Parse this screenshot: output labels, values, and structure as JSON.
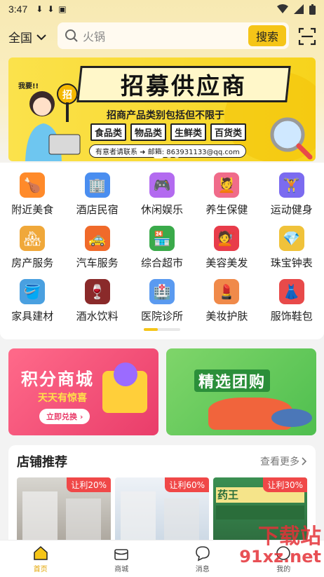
{
  "status_bar": {
    "time": "3:47"
  },
  "search": {
    "city": "全国",
    "placeholder": "火锅",
    "button": "搜索"
  },
  "banner": {
    "title": "招募供应商",
    "subtitle": "招商产品类别包括但不限于",
    "categories": [
      "食品类",
      "物品类",
      "生鲜类",
      "百货类"
    ],
    "contact": "有意者请联系 ➜ 邮箱: 863931133@qq.com",
    "badge": "招",
    "person_text": "我要!!"
  },
  "categories": [
    {
      "label": "附近美食",
      "icon": "food-icon",
      "color": "#ff8a2a",
      "glyph": "🍗"
    },
    {
      "label": "酒店民宿",
      "icon": "hotel-icon",
      "color": "#4a8ef0",
      "glyph": "🏢"
    },
    {
      "label": "休闲娱乐",
      "icon": "gamepad-icon",
      "color": "#b36bf0",
      "glyph": "🎮"
    },
    {
      "label": "养生保健",
      "icon": "spa-icon",
      "color": "#f06b8a",
      "glyph": "💆"
    },
    {
      "label": "运动健身",
      "icon": "fitness-icon",
      "color": "#7b6bf0",
      "glyph": "🏋"
    },
    {
      "label": "房产服务",
      "icon": "building-icon",
      "color": "#f0a83a",
      "glyph": "🏘"
    },
    {
      "label": "汽车服务",
      "icon": "car-icon",
      "color": "#f06a2a",
      "glyph": "🚕"
    },
    {
      "label": "综合超市",
      "icon": "supermarket-icon",
      "color": "#3aaa4a",
      "glyph": "🏪"
    },
    {
      "label": "美容美发",
      "icon": "hair-icon",
      "color": "#e83c4a",
      "glyph": "💇"
    },
    {
      "label": "珠宝钟表",
      "icon": "jewelry-icon",
      "color": "#f0c23a",
      "glyph": "💎"
    },
    {
      "label": "家具建材",
      "icon": "paint-icon",
      "color": "#4aa0e0",
      "glyph": "🪣"
    },
    {
      "label": "酒水饮料",
      "icon": "wine-icon",
      "color": "#8a2a2a",
      "glyph": "🍷"
    },
    {
      "label": "医院诊所",
      "icon": "hospital-icon",
      "color": "#5a9af0",
      "glyph": "🏥"
    },
    {
      "label": "美妆护肤",
      "icon": "cosmetics-icon",
      "color": "#f08a4a",
      "glyph": "💄"
    },
    {
      "label": "服饰鞋包",
      "icon": "clothing-icon",
      "color": "#e84a4a",
      "glyph": "👗"
    }
  ],
  "pager": {
    "pages": 2,
    "current": 1
  },
  "promos": {
    "points_mall": {
      "title": "积分商城",
      "subtitle": "天天有惊喜",
      "button": "立即兑换"
    },
    "group_buy": {
      "title": "精选团购"
    }
  },
  "stores": {
    "title": "店铺推荐",
    "more": "查看更多",
    "items": [
      {
        "tag": "让利20%"
      },
      {
        "tag": "让利60%"
      },
      {
        "tag": "让利30%",
        "sign": "药王"
      }
    ]
  },
  "tabbar": [
    {
      "label": "首页",
      "icon": "home-icon",
      "active": true
    },
    {
      "label": "商城",
      "icon": "mall-icon",
      "active": false
    },
    {
      "label": "消息",
      "icon": "message-icon",
      "active": false
    },
    {
      "label": "我的",
      "icon": "profile-icon",
      "active": false
    }
  ],
  "watermark": {
    "line1": "下载站",
    "line2": "91xz.net"
  },
  "colors": {
    "accent": "#f5c518",
    "tag": "#f04848",
    "active_tab": "#e3a400"
  }
}
